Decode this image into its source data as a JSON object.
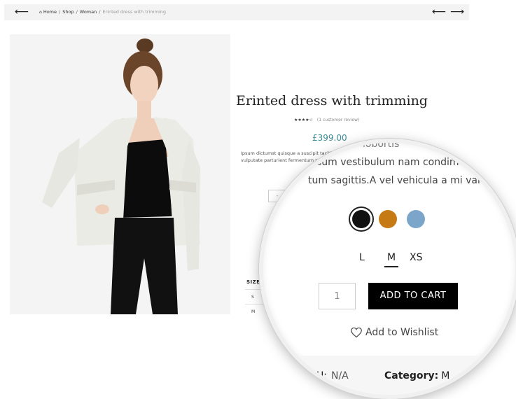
{
  "breadcrumb": {
    "items": [
      "Home",
      "Shop",
      "Woman"
    ],
    "separator": "/",
    "current": "Erinted dress with trimming"
  },
  "nav": {
    "back_icon": "⟵",
    "prev_icon": "⟵",
    "next_icon": "⟶"
  },
  "product": {
    "title": "Erinted dress with trimming",
    "stars": "★★★★☆",
    "reviews": "(1 customer review)",
    "price": "£399.00",
    "price_color": "#3a8a95",
    "description_small": "Ipsum dictumst quisque a suscipit taciti vulputate parturient fermentum suspendisse n",
    "qty_small": "-"
  },
  "size_table": {
    "heading": "SIZE",
    "rows": [
      "S",
      "M"
    ]
  },
  "magnified": {
    "text_line_0": "lobortis",
    "text_line_1": "sum vestibulum nam condimo",
    "text_line_2": "tum sagittis.A vel vehicula a mi variu",
    "swatches": [
      {
        "name": "black",
        "color": "#111111",
        "selected": true
      },
      {
        "name": "orange",
        "color": "#c57a14",
        "selected": false
      },
      {
        "name": "blue",
        "color": "#7ba6c9",
        "selected": false
      }
    ],
    "sizes": [
      "L",
      "M",
      "XS"
    ],
    "selected_size": "M",
    "quantity": "1",
    "add_to_cart": "ADD TO CART",
    "wishlist": "Add to Wishlist",
    "sku_label": "U:",
    "sku_value": "N/A",
    "category_label": "Category:",
    "category_value": "M"
  }
}
